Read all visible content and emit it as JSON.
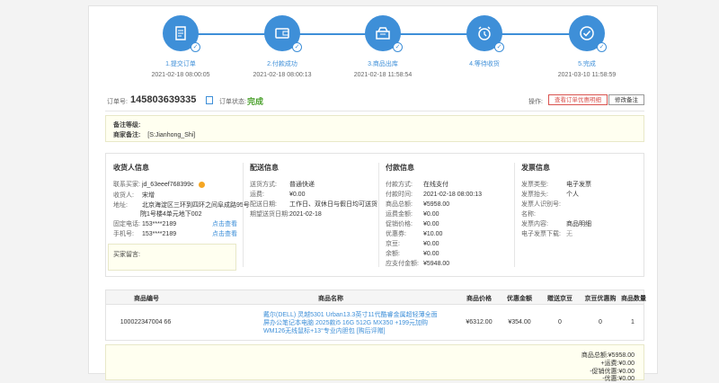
{
  "steps": [
    {
      "label": "1.提交订单",
      "time": "2021-02-18 08:00:05",
      "icon": "document-icon"
    },
    {
      "label": "2.付款成功",
      "time": "2021-02-18 08:00:13",
      "icon": "wallet-icon"
    },
    {
      "label": "3.商品出库",
      "time": "2021-02-18 11:58:54",
      "icon": "box-icon"
    },
    {
      "label": "4.等待收货",
      "time": "",
      "icon": "clock-icon"
    },
    {
      "label": "5.完成",
      "time": "2021-03-10 11:58:59",
      "icon": "check-circle-icon"
    }
  ],
  "order": {
    "number_label": "订单号:",
    "number": "145803639335",
    "status_label": "订单状态:",
    "status": "完成",
    "ops_label": "操作:",
    "btn_invoice": "查看订单优惠明细",
    "btn_remark": "修改备注"
  },
  "remark": {
    "level_label": "备注等级:",
    "merchant_label": "商家备注:",
    "merchant_value": "[S:Jianhong_Shi]"
  },
  "receiver": {
    "title": "收货人信息",
    "account_label": "联系买家:",
    "account": "jd_63eeef768399c",
    "name_label": "收货人:",
    "name": "宋增",
    "addr_label": "地址:",
    "addr_line1": "北京海淀区三环到四环之间阜成路95号",
    "addr_line2": "院1号楼4单元地下002",
    "phone_label": "固定电话:",
    "phone": "153****2189",
    "mobile_label": "手机号:",
    "mobile": "153****2189",
    "view_link": "点击查看",
    "message_label": "买家留言:"
  },
  "delivery": {
    "title": "配送信息",
    "method_label": "送货方式:",
    "method": "普通快递",
    "freight_label": "运费:",
    "freight": "¥0.00",
    "date_label": "配送日期:",
    "date": "工作日、双休日与假日均可送货",
    "expect_label": "期望送货日期:",
    "expect": "2021-02-18"
  },
  "payment": {
    "title": "付款信息",
    "method_label": "付款方式:",
    "method": "在线支付",
    "time_label": "付款时间:",
    "time": "2021-02-18 08:00:13",
    "total_label": "商品总额:",
    "total": "¥5958.00",
    "freight_label": "运费金额:",
    "freight": "¥0.00",
    "promo_label": "促销价格:",
    "promo": "¥0.00",
    "coupon_label": "优惠券:",
    "coupon": "¥10.00",
    "discount_label": "京豆:",
    "discount": "¥0.00",
    "balance_label": "余额:",
    "balance": "¥0.00",
    "pay_label": "应支付金额:",
    "pay": "¥5948.00"
  },
  "invoice": {
    "title": "发票信息",
    "type_label": "发票类型:",
    "type": "电子发票",
    "head_label": "发票抬头:",
    "head": "个人",
    "taxid_label": "发票人识别号:",
    "company_label": "名称:",
    "content_label": "发票内容:",
    "content": "商品明细",
    "download_label": "电子发票下载:",
    "download": "无"
  },
  "goods": {
    "headers": [
      "商品编号",
      "商品名称",
      "商品价格",
      "优惠金额",
      "赠送京豆",
      "京豆优惠购",
      "商品数量"
    ],
    "rows": [
      {
        "sku": "100022347004 66",
        "name": "戴尔(DELL) 灵越5301 Urban13.3英寸11代酷睿金属超轻薄全面屏办公笔记本电脑 2025款i5 16G 512G MX350 +199元加购WM126无线鼠标+13°专业内胆包 [购后评赠]",
        "price": "¥6312.00",
        "discount": "¥354.00",
        "beans": "0",
        "beans_buy": "0",
        "qty": "1"
      }
    ]
  },
  "summary": {
    "total": "商品总额:¥5958.00",
    "freight": "+运费:¥0.00",
    "promo": "-促销优惠:¥0.00",
    "more": "-优惠:¥0.00"
  },
  "colors": {
    "accent": "#3e8fd8",
    "success": "#4aa02c",
    "danger": "#d9534f"
  }
}
